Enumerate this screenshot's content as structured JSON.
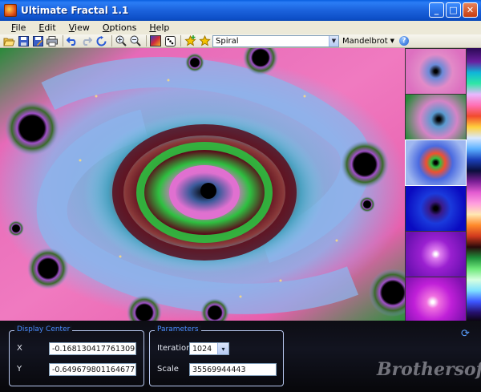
{
  "window": {
    "title": "Ultimate Fractal 1.1"
  },
  "menu": {
    "items": [
      "File",
      "Edit",
      "View",
      "Options",
      "Help"
    ]
  },
  "toolbar": {
    "preset_value": "Spiral",
    "fractal_type": "Mandelbrot",
    "icons": [
      "open-icon",
      "save-icon",
      "save-as-icon",
      "print-icon",
      "undo-icon",
      "redo-icon",
      "reset-icon",
      "zoom-in-icon",
      "zoom-out-icon",
      "color-palette-icon",
      "random-icon",
      "favorites-add-icon",
      "favorites-icon"
    ]
  },
  "display_center": {
    "title": "Display Center",
    "x_label": "X",
    "x_value": "-0.168130417761309",
    "y_label": "Y",
    "y_value": "-0.649679801164677"
  },
  "parameters": {
    "title": "Parameters",
    "iterations_label": "Iterations",
    "iterations_value": "1024",
    "scale_label": "Scale",
    "scale_value": "35569944443"
  },
  "watermark": "Brothersoft",
  "colors": {
    "titlebar": "#1b62dc",
    "panel": "#0d0d14",
    "group_title": "#4b8cff"
  }
}
